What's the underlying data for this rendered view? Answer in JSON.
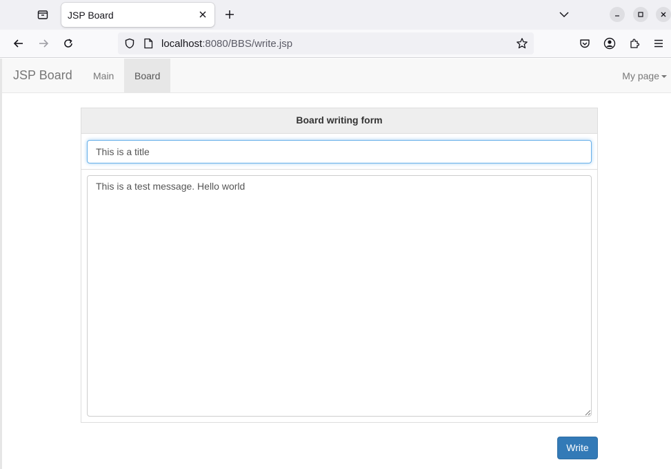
{
  "browser": {
    "tab": {
      "title": "JSP Board"
    },
    "url": {
      "host": "localhost",
      "rest": ":8080/BBS/write.jsp"
    }
  },
  "navbar": {
    "brand": "JSP Board",
    "items": [
      {
        "label": "Main",
        "active": false
      },
      {
        "label": "Board",
        "active": true
      }
    ],
    "right_menu": "My page"
  },
  "form": {
    "heading": "Board writing form",
    "title_value": "This is a title",
    "content_value": "This is a test message. Hello world",
    "submit_label": "Write"
  },
  "colors": {
    "primary_button": "#337ab7",
    "navbar_bg": "#f8f8f8",
    "focus_border": "#66afe9"
  }
}
